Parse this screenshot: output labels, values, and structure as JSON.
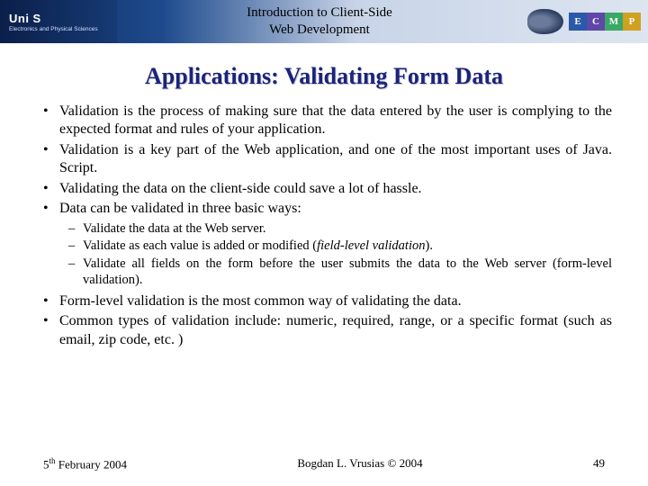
{
  "header": {
    "logo_title": "Uni S",
    "logo_subtitle": "Electronics and Physical Sciences",
    "course_line1": "Introduction to Client-Side",
    "course_line2": "Web Development",
    "badges": [
      "E",
      "C",
      "M",
      "P"
    ]
  },
  "slide": {
    "title": "Applications: Validating Form Data",
    "bullets_a": [
      "Validation is the process of making sure that the data entered by the user is complying to the expected format and rules of your application.",
      "Validation is a key part of the Web application, and one of the most important uses of Java. Script.",
      "Validating the data on the client-side could save a lot of hassle.",
      "Data can be validated in three basic ways:"
    ],
    "subbullets": [
      "Validate the data at the Web server.",
      "Validate as each value is added or modified (<em>field-level validation</em>).",
      "Validate all fields on the form before the user submits the data to the Web server (form-level validation)."
    ],
    "bullets_b": [
      "Form-level validation is the most common way of validating the data.",
      "Common types of validation include: numeric, required, range, or a specific format (such as email, zip code, etc. )"
    ]
  },
  "footer": {
    "date_prefix": "5",
    "date_sup": "th",
    "date_rest": " February 2004",
    "author": "Bogdan L. Vrusias © 2004",
    "page": "49"
  }
}
